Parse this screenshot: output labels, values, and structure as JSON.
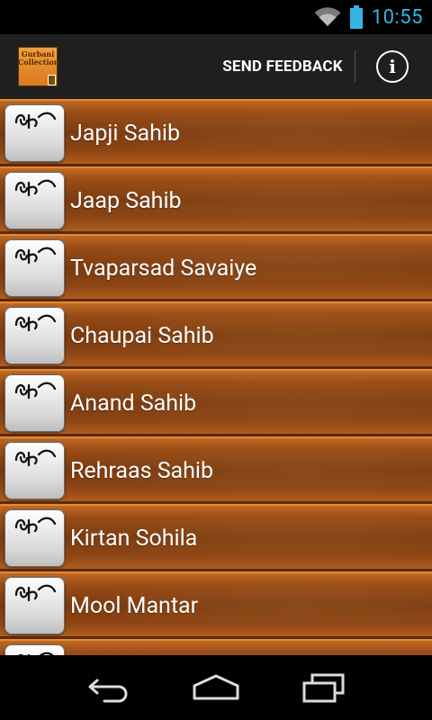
{
  "status_bar": {
    "time": "10:55",
    "wifi_icon": "wifi-icon",
    "battery_icon": "battery-icon",
    "accent_color": "#33b5e5"
  },
  "action_bar": {
    "logo_text": "Gurbani Collection",
    "send_feedback_label": "SEND FEEDBACK",
    "info_label": "i"
  },
  "list": {
    "items": [
      {
        "label": "Japji Sahib"
      },
      {
        "label": "Jaap Sahib"
      },
      {
        "label": "Tvaparsad Savaiye"
      },
      {
        "label": "Chaupai Sahib"
      },
      {
        "label": "Anand Sahib"
      },
      {
        "label": "Rehraas Sahib"
      },
      {
        "label": "Kirtan Sohila"
      },
      {
        "label": "Mool Mantar"
      },
      {
        "label": ""
      }
    ],
    "item_icon": "ik-onkar-icon"
  },
  "nav_bar": {
    "back_icon": "back-icon",
    "home_icon": "home-icon",
    "recents_icon": "recents-icon"
  }
}
